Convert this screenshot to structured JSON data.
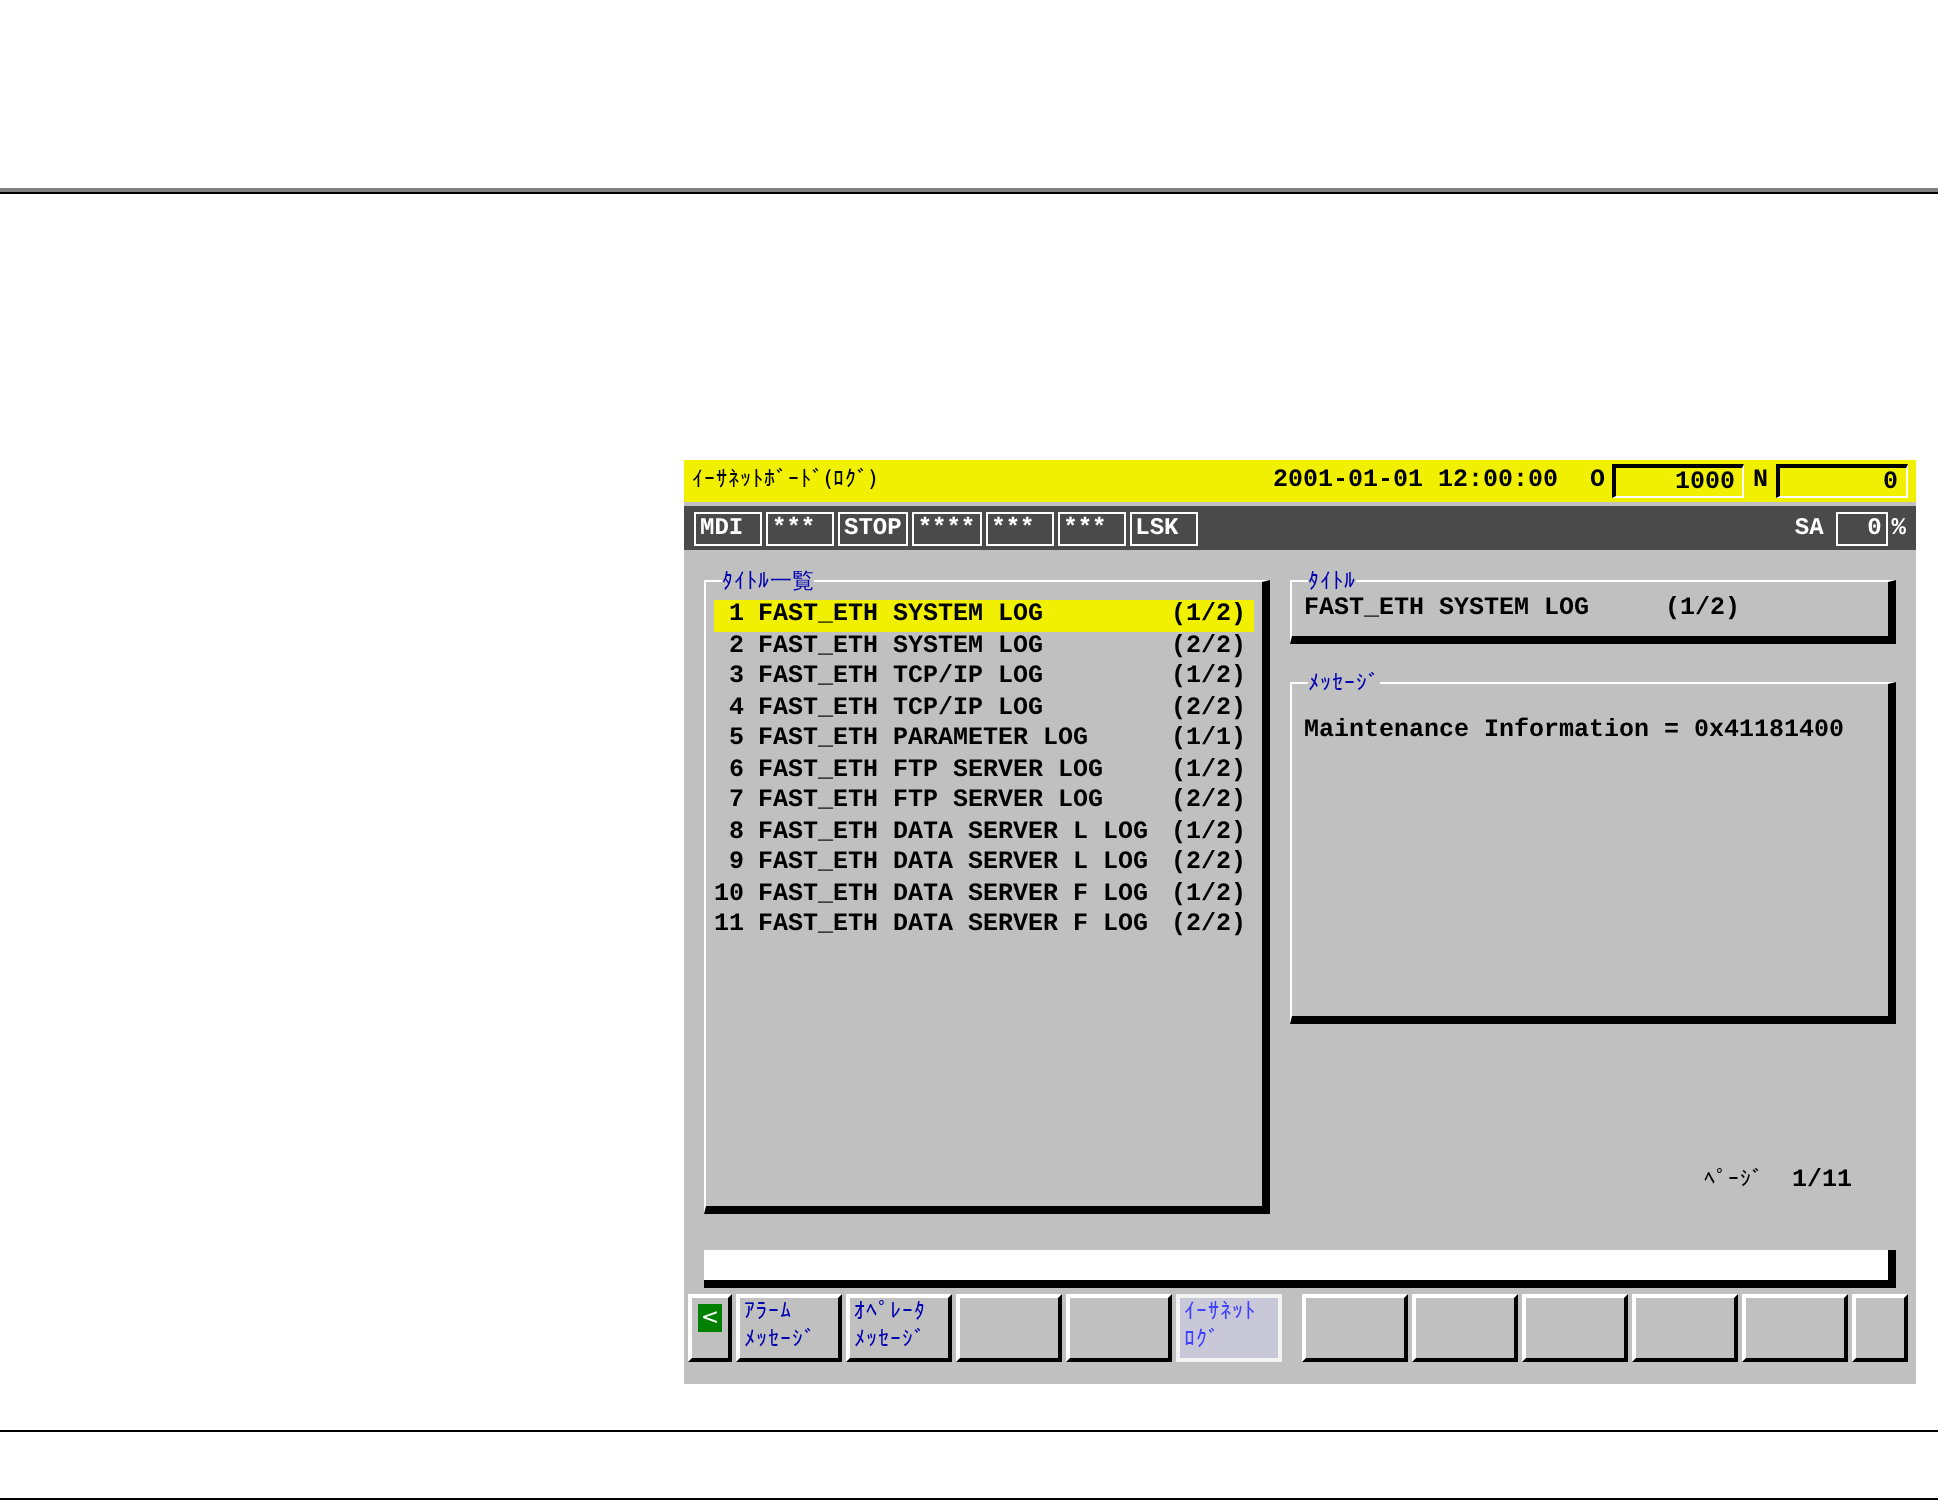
{
  "header": {
    "title": "ｲｰｻﾈｯﾄﾎﾞｰﾄﾞ(ﾛｸﾞ)",
    "datetime": "2001-01-01 12:00:00",
    "o_label": "O",
    "o_value": "1000",
    "n_label": "N",
    "n_value": "0"
  },
  "status_bar": {
    "items": [
      "MDI",
      "***",
      "STOP",
      "****",
      "***",
      "***",
      "LSK"
    ],
    "sa_label": "SA",
    "sa_value": "0",
    "percent": "%"
  },
  "title_list": {
    "heading": "ﾀｲﾄﾙ一覧",
    "rows": [
      {
        "number": "1",
        "title": "FAST_ETH SYSTEM LOG",
        "page": "(1/2)",
        "selected": true
      },
      {
        "number": "2",
        "title": "FAST_ETH SYSTEM LOG",
        "page": "(2/2)",
        "selected": false
      },
      {
        "number": "3",
        "title": "FAST_ETH TCP/IP LOG",
        "page": "(1/2)",
        "selected": false
      },
      {
        "number": "4",
        "title": "FAST_ETH TCP/IP LOG",
        "page": "(2/2)",
        "selected": false
      },
      {
        "number": "5",
        "title": "FAST_ETH PARAMETER LOG",
        "page": "(1/1)",
        "selected": false
      },
      {
        "number": "6",
        "title": "FAST_ETH FTP SERVER LOG",
        "page": "(1/2)",
        "selected": false
      },
      {
        "number": "7",
        "title": "FAST_ETH FTP SERVER LOG",
        "page": "(2/2)",
        "selected": false
      },
      {
        "number": "8",
        "title": "FAST_ETH DATA SERVER L LOG",
        "page": "(1/2)",
        "selected": false
      },
      {
        "number": "9",
        "title": "FAST_ETH DATA SERVER L LOG",
        "page": "(2/2)",
        "selected": false
      },
      {
        "number": "10",
        "title": "FAST_ETH DATA SERVER F LOG",
        "page": "(1/2)",
        "selected": false
      },
      {
        "number": "11",
        "title": "FAST_ETH DATA SERVER F LOG",
        "page": "(2/2)",
        "selected": false
      }
    ]
  },
  "title_box": {
    "heading": "ﾀｲﾄﾙ",
    "title": "FAST_ETH SYSTEM LOG",
    "page": "(1/2)"
  },
  "message_box": {
    "heading": "ﾒｯｾｰｼﾞ",
    "text": "Maintenance Information = 0x41181400"
  },
  "page_indicator": {
    "label": "ﾍﾟｰｼﾞ",
    "value": "1/11"
  },
  "soft_keys": [
    {
      "kind": "back",
      "lines": [
        "<"
      ],
      "selected": false
    },
    {
      "kind": "key",
      "lines": [
        "ｱﾗｰﾑ",
        "ﾒｯｾｰｼﾞ"
      ],
      "selected": false
    },
    {
      "kind": "key",
      "lines": [
        "ｵﾍﾟﾚｰﾀ",
        "ﾒｯｾｰｼﾞ"
      ],
      "selected": false
    },
    {
      "kind": "blank"
    },
    {
      "kind": "blank"
    },
    {
      "kind": "key",
      "lines": [
        "ｲｰｻﾈｯﾄ",
        "ﾛｸﾞ"
      ],
      "selected": true
    },
    {
      "kind": "gap"
    },
    {
      "kind": "blank"
    },
    {
      "kind": "blank"
    },
    {
      "kind": "blank"
    },
    {
      "kind": "blank"
    },
    {
      "kind": "blank"
    },
    {
      "kind": "more"
    }
  ]
}
